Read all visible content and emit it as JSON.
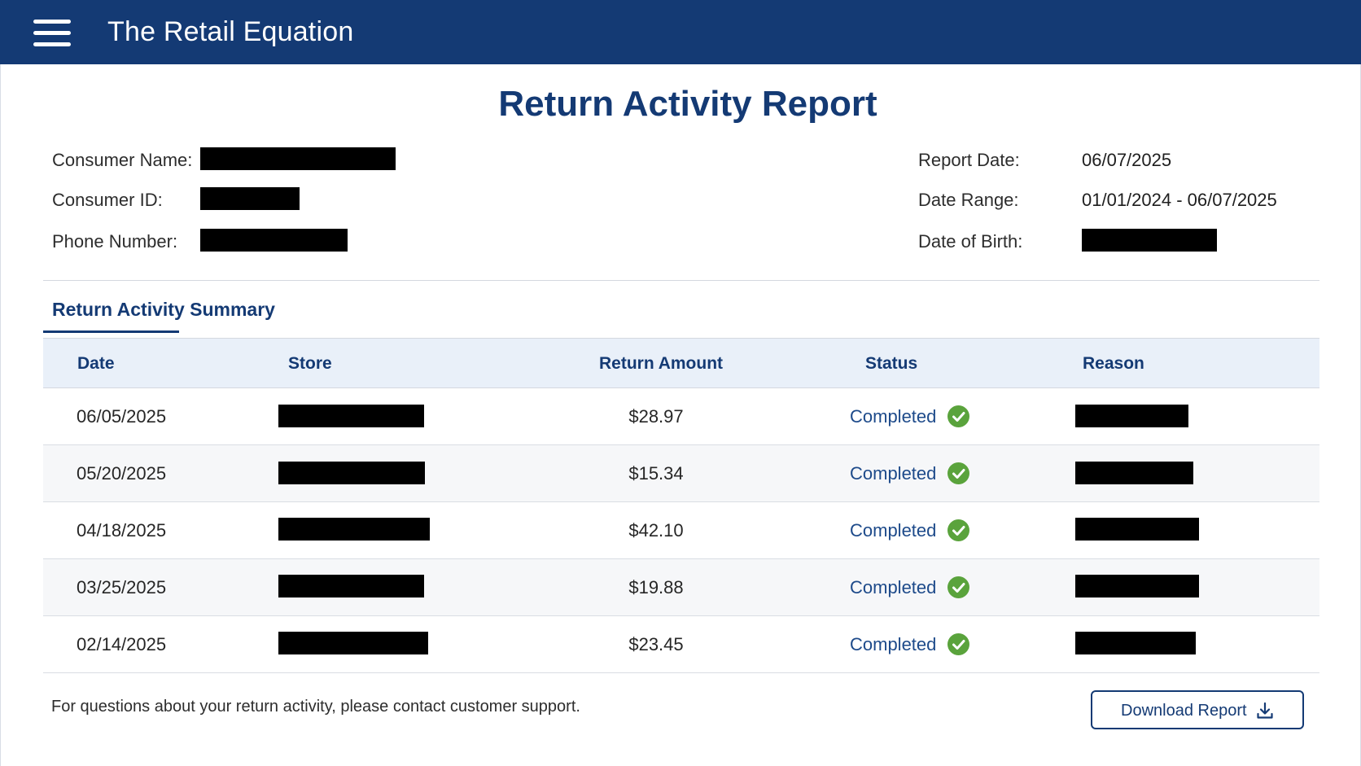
{
  "app": {
    "title": "The Retail Equation"
  },
  "report": {
    "title": "Return Activity Report",
    "consumer_name_label": "Consumer Name:",
    "consumer_id_label": "Consumer ID:",
    "phone_label": "Phone Number:",
    "report_date_label": "Report Date:",
    "report_date_value": "06/07/2025",
    "date_range_label": "Date Range:",
    "date_range_value": "01/01/2024 - 06/07/2025",
    "dob_label": "Date of Birth:"
  },
  "summary": {
    "tab_label": "Return Activity Summary",
    "columns": {
      "date": "Date",
      "store": "Store",
      "amount": "Return Amount",
      "status": "Status",
      "reason": "Reason"
    },
    "rows": [
      {
        "date": "06/05/2025",
        "amount": "$28.97",
        "status": "Completed"
      },
      {
        "date": "05/20/2025",
        "amount": "$15.34",
        "status": "Completed"
      },
      {
        "date": "04/18/2025",
        "amount": "$42.10",
        "status": "Completed"
      },
      {
        "date": "03/25/2025",
        "amount": "$19.88",
        "status": "Completed"
      },
      {
        "date": "02/14/2025",
        "amount": "$23.45",
        "status": "Completed"
      }
    ]
  },
  "footer": {
    "note": "For questions about your return activity, please contact customer support.",
    "download_label": "Download Report"
  },
  "colors": {
    "brand": "#143a74",
    "status_ok": "#5aa33c",
    "header_bg": "#e9f0f9"
  },
  "icons": [
    "menu-icon",
    "check-circle-icon",
    "download-icon"
  ]
}
